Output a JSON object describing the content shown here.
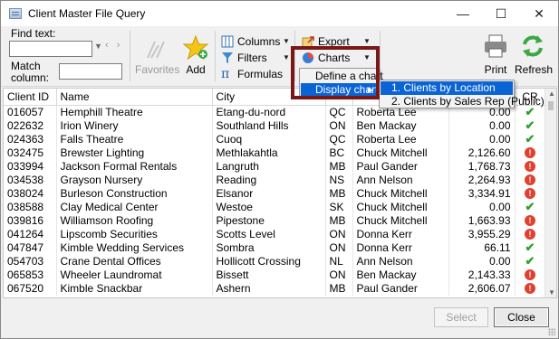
{
  "window": {
    "title": "Client Master File Query",
    "minimize": "—",
    "maximize": "☐",
    "close": "✕"
  },
  "toolbar": {
    "find_label": "Find text:",
    "match_label_1": "Match",
    "match_label_2": "column:",
    "favorites_label": "Favorites",
    "add_label": "Add",
    "columns_label": "Columns",
    "filters_label": "Filters",
    "formulas_label": "Formulas",
    "export_label": "Export",
    "charts_label": "Charts",
    "print_label": "Print",
    "refresh_label": "Refresh"
  },
  "chart_menu": {
    "items": [
      {
        "label": "Define a chart"
      },
      {
        "label": "Display chart"
      }
    ],
    "submenu": [
      {
        "label": "1. Clients by Location"
      },
      {
        "label": "2. Clients by Sales Rep (Public)"
      }
    ]
  },
  "table": {
    "columns": [
      "Client ID",
      "Name",
      "City",
      "",
      "",
      "",
      "CR"
    ],
    "rows": [
      {
        "id": "016057",
        "name": "Hemphill Theatre",
        "city": "Etang-du-nord",
        "prov": "QC",
        "rep": "Roberta Lee",
        "amount": "0.00",
        "cr": "ok"
      },
      {
        "id": "022632",
        "name": "Irion Winery",
        "city": "Southland Hills",
        "prov": "ON",
        "rep": "Ben Mackay",
        "amount": "0.00",
        "cr": "ok"
      },
      {
        "id": "024363",
        "name": "Falls Theatre",
        "city": "Cuoq",
        "prov": "QC",
        "rep": "Roberta Lee",
        "amount": "0.00",
        "cr": "ok"
      },
      {
        "id": "032475",
        "name": "Brewster Lighting",
        "city": "Methlakahtla",
        "prov": "BC",
        "rep": "Chuck Mitchell",
        "amount": "2,126.60",
        "cr": "warn"
      },
      {
        "id": "033994",
        "name": "Jackson Formal Rentals",
        "city": "Langruth",
        "prov": "MB",
        "rep": "Paul Gander",
        "amount": "1,768.73",
        "cr": "warn"
      },
      {
        "id": "034538",
        "name": "Grayson Nursery",
        "city": "Reading",
        "prov": "NS",
        "rep": "Ann Nelson",
        "amount": "2,264.93",
        "cr": "warn"
      },
      {
        "id": "038024",
        "name": "Burleson Construction",
        "city": "Elsanor",
        "prov": "MB",
        "rep": "Chuck Mitchell",
        "amount": "3,334.91",
        "cr": "warn"
      },
      {
        "id": "038588",
        "name": "Clay Medical Center",
        "city": "Westoe",
        "prov": "SK",
        "rep": "Chuck Mitchell",
        "amount": "0.00",
        "cr": "ok"
      },
      {
        "id": "039816",
        "name": "Williamson Roofing",
        "city": "Pipestone",
        "prov": "MB",
        "rep": "Chuck Mitchell",
        "amount": "1,663.93",
        "cr": "warn"
      },
      {
        "id": "041264",
        "name": "Lipscomb Securities",
        "city": "Scotts Level",
        "prov": "ON",
        "rep": "Donna Kerr",
        "amount": "3,955.29",
        "cr": "warn"
      },
      {
        "id": "047847",
        "name": "Kimble Wedding Services",
        "city": "Sombra",
        "prov": "ON",
        "rep": "Donna Kerr",
        "amount": "66.11",
        "cr": "ok"
      },
      {
        "id": "054703",
        "name": "Crane Dental Offices",
        "city": "Hollicott Crossing",
        "prov": "NL",
        "rep": "Ann Nelson",
        "amount": "0.00",
        "cr": "ok"
      },
      {
        "id": "065853",
        "name": "Wheeler Laundromat",
        "city": "Bissett",
        "prov": "ON",
        "rep": "Ben Mackay",
        "amount": "2,143.33",
        "cr": "warn"
      },
      {
        "id": "067520",
        "name": "Kimble Snackbar",
        "city": "Ashern",
        "prov": "MB",
        "rep": "Paul Gander",
        "amount": "2,606.07",
        "cr": "warn"
      }
    ]
  },
  "footer": {
    "select_label": "Select",
    "close_label": "Close"
  },
  "colors": {
    "highlight": "#0a64d6",
    "callout": "#7a1717",
    "ok": "#2ea12e",
    "warn": "#e0402f"
  }
}
